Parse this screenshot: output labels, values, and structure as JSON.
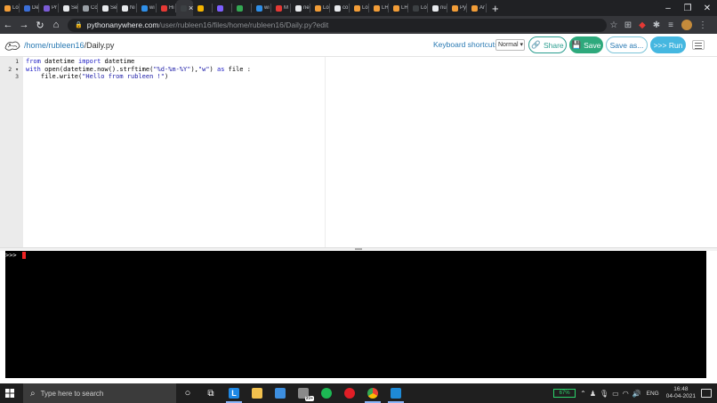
{
  "browser": {
    "tabs": [
      {
        "label": "Lo",
        "color": "#f29d38"
      },
      {
        "label": "De",
        "color": "#3b6ed8"
      },
      {
        "label": "Pr",
        "color": "#7b5cd6"
      },
      {
        "label": "Se",
        "color": "#e8eaed"
      },
      {
        "label": "Co",
        "color": "#9aa0a6"
      },
      {
        "label": "Se",
        "color": "#e8eaed"
      },
      {
        "label": "Ni",
        "color": "#e8eaed"
      },
      {
        "label": "wi",
        "color": "#2f8fe8"
      },
      {
        "label": "Hi",
        "color": "#e53935"
      },
      {
        "label": "",
        "color": "#3c4043",
        "active": true
      },
      {
        "label": "",
        "color": "#f4b400"
      },
      {
        "label": "",
        "color": "#7d5fff"
      },
      {
        "label": "",
        "color": "#34a853"
      },
      {
        "label": "wi",
        "color": "#2f8fe8"
      },
      {
        "label": "M",
        "color": "#e53935"
      },
      {
        "label": "ne",
        "color": "#e8eaed"
      },
      {
        "label": "Lo",
        "color": "#f29d38"
      },
      {
        "label": "co",
        "color": "#e8eaed"
      },
      {
        "label": "Lo",
        "color": "#f29d38"
      },
      {
        "label": "LH",
        "color": "#f29d38"
      },
      {
        "label": "LH",
        "color": "#f29d38"
      },
      {
        "label": "Lo",
        "color": "#3c4043"
      },
      {
        "label": "nu",
        "color": "#e8eaed"
      },
      {
        "label": "Py",
        "color": "#f29d38"
      },
      {
        "label": "Ar",
        "color": "#f29d38"
      }
    ],
    "new_tab": "+",
    "window_controls": {
      "minimize": "–",
      "restore": "❐",
      "close": "✕"
    },
    "url_host": "pythonanywhere.com",
    "url_path": "/user/rubleen16/files/home/rubleen16/Daily.py?edit"
  },
  "header": {
    "breadcrumb": [
      {
        "text": "/home/",
        "link": true
      },
      {
        "text": "rubleen16",
        "link": true
      },
      {
        "text": "/Daily.py",
        "link": false
      }
    ],
    "keyboard_label": "Keyboard shortcuts:",
    "keyboard_mode": "Normal",
    "share_label": "Share",
    "save_label": "Save",
    "saveas_label": "Save as...",
    "run_label": ">>> Run"
  },
  "editor": {
    "line_numbers": [
      "1",
      "2",
      "3"
    ],
    "fold_marker": "2 ▾"
  },
  "console": {
    "prompt": ">>>"
  },
  "taskbar": {
    "search_placeholder": "Type here to search",
    "mail_badge": "99+",
    "battery": "67%",
    "language": "ENG",
    "time": "16:48",
    "date": "04-04-2021"
  }
}
